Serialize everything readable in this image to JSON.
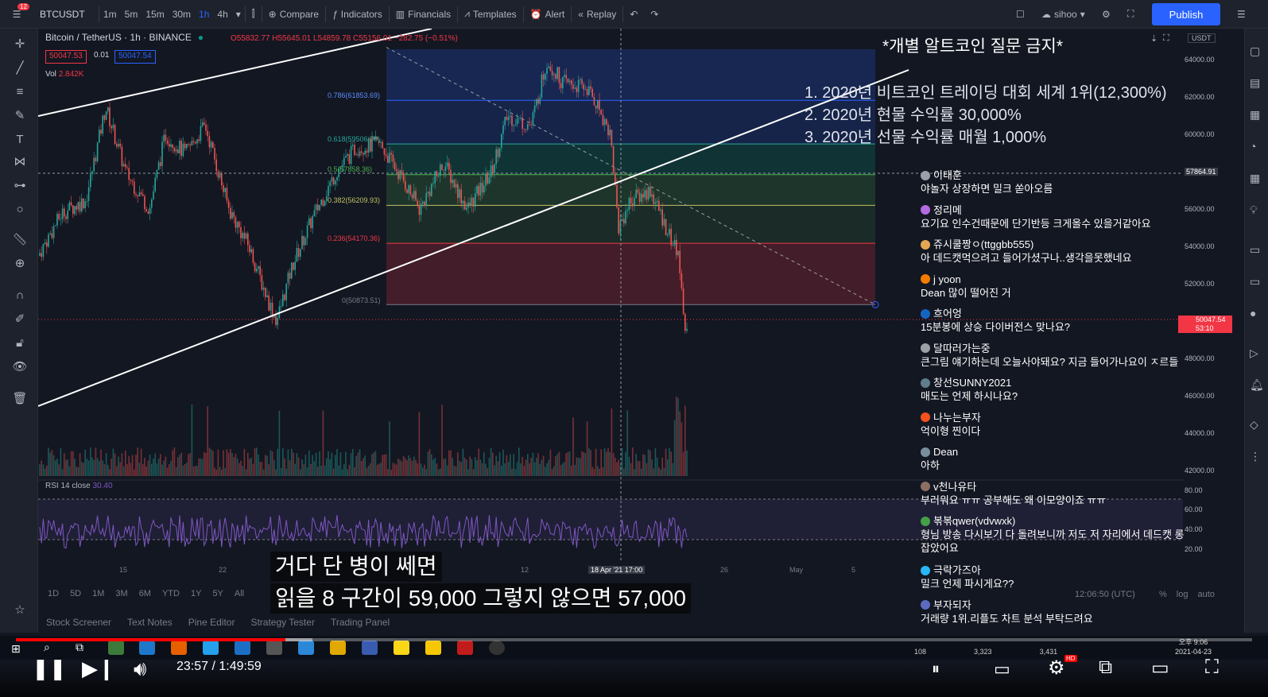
{
  "topbar": {
    "menu_badge": "12",
    "symbol": "BTCUSDT",
    "intervals": [
      "1m",
      "5m",
      "15m",
      "30m",
      "1h",
      "4h"
    ],
    "active_interval": "1h",
    "compare": "Compare",
    "indicators": "Indicators",
    "financials": "Financials",
    "templates": "Templates",
    "alert": "Alert",
    "replay": "Replay",
    "user": "sihoo",
    "publish": "Publish"
  },
  "legend": {
    "title": "Bitcoin / TetherUS · 1h · BINANCE",
    "ohlc": "O55832.77 H55645.01 L54859.78 C55156.01 −282.75 (−0.51%)",
    "bid": "50047.53",
    "spread": "0.01",
    "ask": "50047.54",
    "vol_label": "Vol",
    "vol_value": "2.842K"
  },
  "y_axis": {
    "currency": "USDT",
    "ticks": [
      "64000.00",
      "62000.00",
      "60000.00",
      "58000.00",
      "56000.00",
      "54000.00",
      "52000.00",
      "50000.00",
      "48000.00",
      "46000.00",
      "44000.00",
      "42000.00"
    ],
    "crosshair_price": "57864.91",
    "last_price": "50047.54",
    "last_time": "53:10",
    "rsi_ticks": [
      "80.00",
      "60.00",
      "40.00",
      "20.00"
    ]
  },
  "x_axis": {
    "ticks": [
      "15",
      "22",
      "12",
      "18 Apr '21  17:00",
      "26",
      "May",
      "5"
    ],
    "clock": "12:06:50 (UTC)",
    "scale_opts": [
      "%",
      "log",
      "auto"
    ]
  },
  "fib": {
    "levels": [
      "0.786(61853.69)",
      "0.618(59506.78)",
      "0.5(57858.36)",
      "0.382(56209.93)",
      "0.236(54170.36)",
      "0(50873.51)"
    ],
    "colors": [
      "#2962ff",
      "#089981",
      "#4caf50",
      "#9c9c3a",
      "#f23645",
      "#787b86"
    ]
  },
  "rsi": {
    "label": "RSI 14 close",
    "value": "30.40"
  },
  "overlay": {
    "warning": "*개별 알트코인 질문 금지*",
    "records": [
      "1. 2020년 비트코인 트레이딩 대회 세계 1위(12,300%)",
      "2. 2020년 현물 수익률 30,000%",
      "3. 2020년 선물 수익률 매월 1,000%"
    ]
  },
  "chat": [
    {
      "name": "이태훈",
      "text": "야놀자 상장하면 밀크 쏟아오름",
      "color": "#9aa0a6"
    },
    {
      "name": "정리메",
      "text": "요기요 인수건때문에 단기반등 크게올수 있을거같아요",
      "color": "#b36ae2"
    },
    {
      "name": "쥬시쿨짱ㅇ(ttggbb555)",
      "text": "아 데드캣먹으려고 들어가셨구나..생각을못했네요",
      "color": "#e4a853"
    },
    {
      "name": "j yoon",
      "text": "Dean 많이 떨어진 거",
      "color": "#f57c00"
    },
    {
      "name": "흐어엉",
      "text": "15분봉에 상승 다이버전스 맞나요?",
      "color": "#1565c0"
    },
    {
      "name": "달따러가는중",
      "text": "큰그림 얘기하는데 오늘사야돼요? 지금 들어가나요이 ㅈ르들",
      "color": "#9aa0a6"
    },
    {
      "name": "창선SUNNY2021",
      "text": "매도는 언제 하시나요?",
      "color": "#607d8b"
    },
    {
      "name": "나누는부자",
      "text": "억이형 찐이다",
      "color": "#f4511e"
    },
    {
      "name": "Dean",
      "text": "아하",
      "color": "#78909c"
    },
    {
      "name": "v천나유타",
      "text": "부러워요 ㅠㅠ 공부해도 왜 이모양이죠 ㅠㅠ",
      "color": "#8d6e63"
    },
    {
      "name": "볶볶qwer(vdvwxk)",
      "text": "형님 방송 다시보기 다 돌려보니까 저도 저 자리에서 데드캣 롱 잡았어요",
      "color": "#43a047"
    },
    {
      "name": "극락가즈아",
      "text": "밀크 언제 파시게요??",
      "color": "#29b6f6"
    },
    {
      "name": "부자되자",
      "text": "거래량 1위.리플도 차트 분석 부탁드려요",
      "color": "#5c6bc0"
    }
  ],
  "chat_footer": {
    "likes": "108",
    "views": "3,323",
    "viewers": "3,431"
  },
  "subtitles": [
    "거다 단 병이 쎄면",
    "읽을 8 구간이 59,000 그렇지 않으면 57,000"
  ],
  "bottom_panel": [
    "Stock Screener",
    "Text Notes",
    "Pine Editor",
    "Strategy Tester",
    "Trading Panel"
  ],
  "ranges": [
    "1D",
    "5D",
    "1M",
    "3M",
    "6M",
    "YTD",
    "1Y",
    "5Y",
    "All"
  ],
  "taskbar": {
    "time": "오후 9:06",
    "date": "2021-04-23"
  },
  "player": {
    "current": "23:57",
    "total": "1:49:59",
    "time_display": "23:57 / 1:49:59",
    "progress": 0.218,
    "buffered": 0.24,
    "hd_badge": "HD"
  }
}
